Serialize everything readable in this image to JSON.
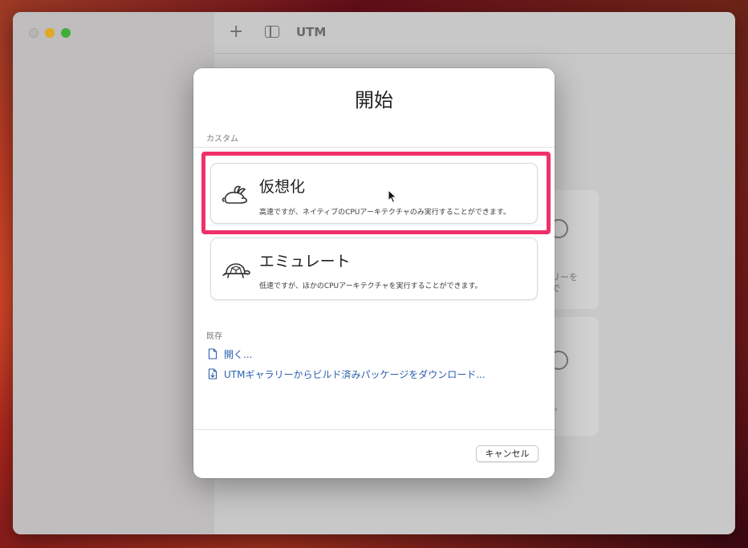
{
  "window": {
    "title": "UTM"
  },
  "toolbar": {
    "add_label": "+"
  },
  "background_cards": {
    "card1_text_line1": "リーを",
    "card1_text_line2": "で",
    "card2_text": "。"
  },
  "dialog": {
    "title": "開始",
    "custom_section_label": "カスタム",
    "options": [
      {
        "title": "仮想化",
        "description": "高速ですが、ネイティブのCPUアーキテクチャのみ実行することができます。",
        "icon": "rabbit-icon"
      },
      {
        "title": "エミュレート",
        "description": "低速ですが、ほかのCPUアーキテクチャを実行することができます。",
        "icon": "turtle-icon"
      }
    ],
    "existing_section_label": "既存",
    "links": [
      {
        "label": "開く...",
        "icon": "document-icon"
      },
      {
        "label": "UTMギャラリーからビルド済みパッケージをダウンロード...",
        "icon": "download-document-icon"
      }
    ],
    "cancel_label": "キャンセル"
  },
  "colors": {
    "highlight": "#f0306a",
    "link": "#2a5fae",
    "traffic_min": "#e0a823",
    "traffic_max": "#3fae3a"
  }
}
